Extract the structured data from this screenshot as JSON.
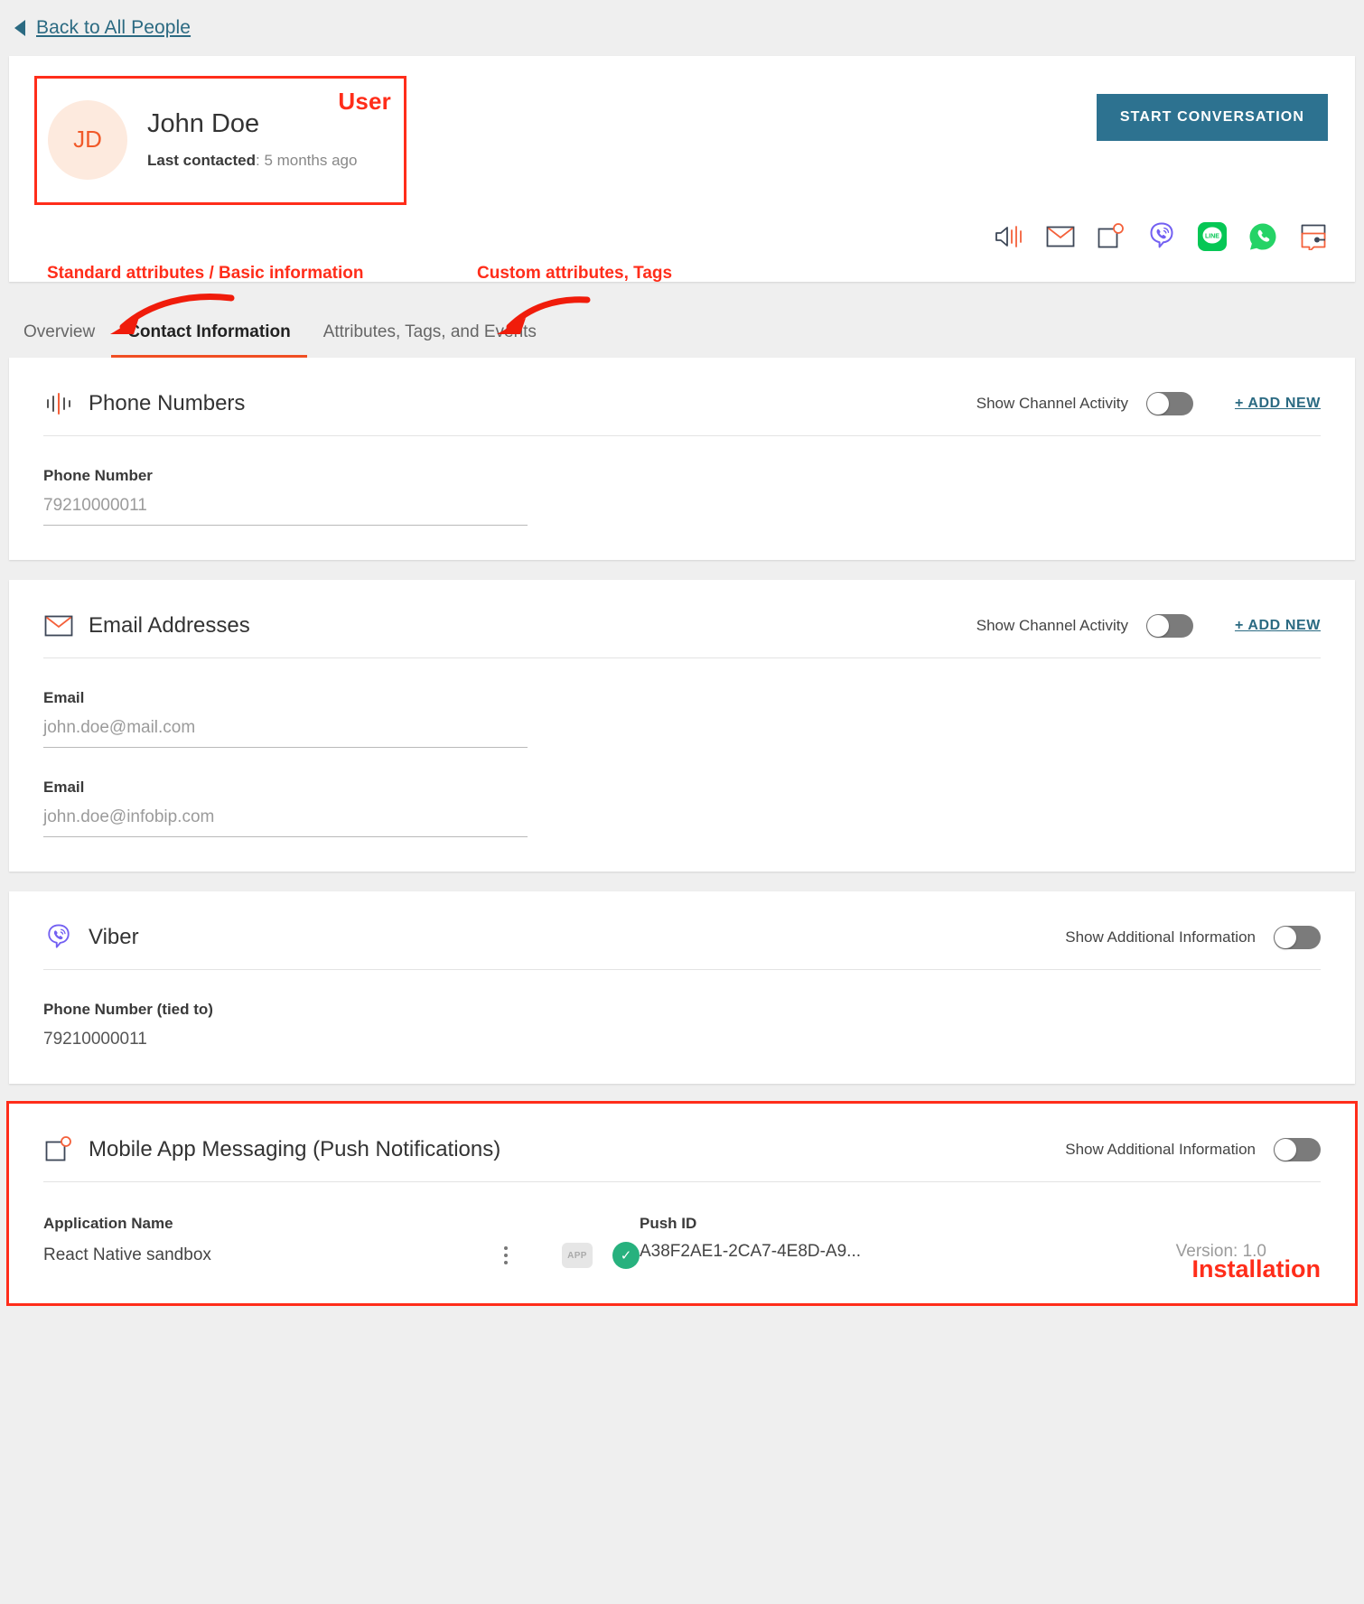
{
  "nav": {
    "back_label": "Back to All People",
    "back_icon": "triangle-left-icon"
  },
  "profile": {
    "initials": "JD",
    "name": "John Doe",
    "last_contacted_label": "Last contacted",
    "last_contacted_value": "5 months ago",
    "annotation": "User",
    "start_conversation_label": "START CONVERSATION"
  },
  "channel_icons": [
    {
      "name": "sms-speaker-icon",
      "title": "SMS"
    },
    {
      "name": "email-envelope-icon",
      "title": "Email"
    },
    {
      "name": "push-notification-icon",
      "title": "Mobile App Messaging"
    },
    {
      "name": "viber-icon",
      "title": "Viber"
    },
    {
      "name": "line-icon",
      "title": "LINE"
    },
    {
      "name": "whatsapp-icon",
      "title": "WhatsApp"
    },
    {
      "name": "conversations-icon",
      "title": "Conversations"
    }
  ],
  "annotations": {
    "standard_attributes": "Standard attributes / Basic information",
    "custom_attributes": "Custom attributes, Tags",
    "installation": "Installation"
  },
  "tabs": [
    {
      "label": "Overview",
      "active": false
    },
    {
      "label": "Contact Information",
      "active": true
    },
    {
      "label": "Attributes, Tags, and Events",
      "active": false
    }
  ],
  "sections": {
    "phone": {
      "icon": "sms-bars-icon",
      "title": "Phone Numbers",
      "toggle_label": "Show Channel Activity",
      "toggle_on": false,
      "add_new_label": "+ ADD NEW",
      "fields": [
        {
          "label": "Phone Number",
          "value": "79210000011"
        }
      ]
    },
    "email": {
      "icon": "email-envelope-icon",
      "title": "Email Addresses",
      "toggle_label": "Show Channel Activity",
      "toggle_on": false,
      "add_new_label": "+ ADD NEW",
      "fields": [
        {
          "label": "Email",
          "value": "john.doe@mail.com"
        },
        {
          "label": "Email",
          "value": "john.doe@infobip.com"
        }
      ]
    },
    "viber": {
      "icon": "viber-icon",
      "title": "Viber",
      "toggle_label": "Show Additional Information",
      "toggle_on": false,
      "fields": [
        {
          "label": "Phone Number (tied to)",
          "value": "79210000011"
        }
      ]
    },
    "push": {
      "icon": "push-notification-icon",
      "title": "Mobile App Messaging (Push Notifications)",
      "toggle_label": "Show Additional Information",
      "toggle_on": false,
      "app_name_label": "Application Name",
      "app_name_value": "React Native sandbox",
      "push_id_label": "Push ID",
      "push_id_value": "A38F2AE1-2CA7-4E8D-A9...",
      "version_text": "Version: 1.0",
      "app_chip_label": "APP",
      "status_icon": "check-circle-icon",
      "kebab_icon": "more-vertical-icon"
    }
  },
  "colors": {
    "accent_orange": "#f04e23",
    "link_teal": "#2b6a82",
    "button_teal": "#2d7290",
    "annotation_red": "#ff2d1a",
    "toggle_off": "#7b7b7b",
    "status_green": "#27b17e",
    "page_bg": "#efefef"
  }
}
